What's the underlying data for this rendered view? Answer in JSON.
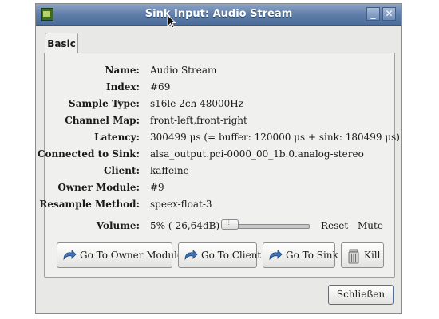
{
  "window": {
    "title": "Sink Input: Audio Stream",
    "min_glyph": "_",
    "close_glyph": "✕"
  },
  "tabs": [
    {
      "label": "Basic",
      "active": true
    }
  ],
  "fields": {
    "name": {
      "label": "Name:",
      "value": "Audio Stream"
    },
    "index": {
      "label": "Index:",
      "value": "#69"
    },
    "sample_type": {
      "label": "Sample Type:",
      "value": "s16le 2ch 48000Hz"
    },
    "channel_map": {
      "label": "Channel Map:",
      "value": "front-left,front-right"
    },
    "latency": {
      "label": "Latency:",
      "value": "300499 μs (= buffer: 120000 μs + sink: 180499 μs)"
    },
    "connected_to_sink": {
      "label": "Connected to Sink:",
      "value": "alsa_output.pci-0000_00_1b.0.analog-stereo"
    },
    "client": {
      "label": "Client:",
      "value": "kaffeine"
    },
    "owner_module": {
      "label": "Owner Module:",
      "value": "#9"
    },
    "resample_method": {
      "label": "Resample Method:",
      "value": "speex-float-3"
    }
  },
  "volume": {
    "label": "Volume:",
    "value_text": "5% (-26,64dB)",
    "level_fraction": 0.05,
    "reset_label": "Reset",
    "mute_label": "Mute"
  },
  "actions": {
    "owner_module": "Go To Owner Module",
    "client": "Go To Client",
    "sink": "Go To Sink",
    "kill": "Kill"
  },
  "footer": {
    "close": "Schließen"
  },
  "colors": {
    "titlebar": "#5f7ea9",
    "window_bg": "#e8e8e7",
    "arrow_icon": "#3f74b8"
  },
  "icons": {
    "app": "app-icon",
    "go_to": "curved-arrow-icon",
    "kill": "trash-can-icon"
  }
}
